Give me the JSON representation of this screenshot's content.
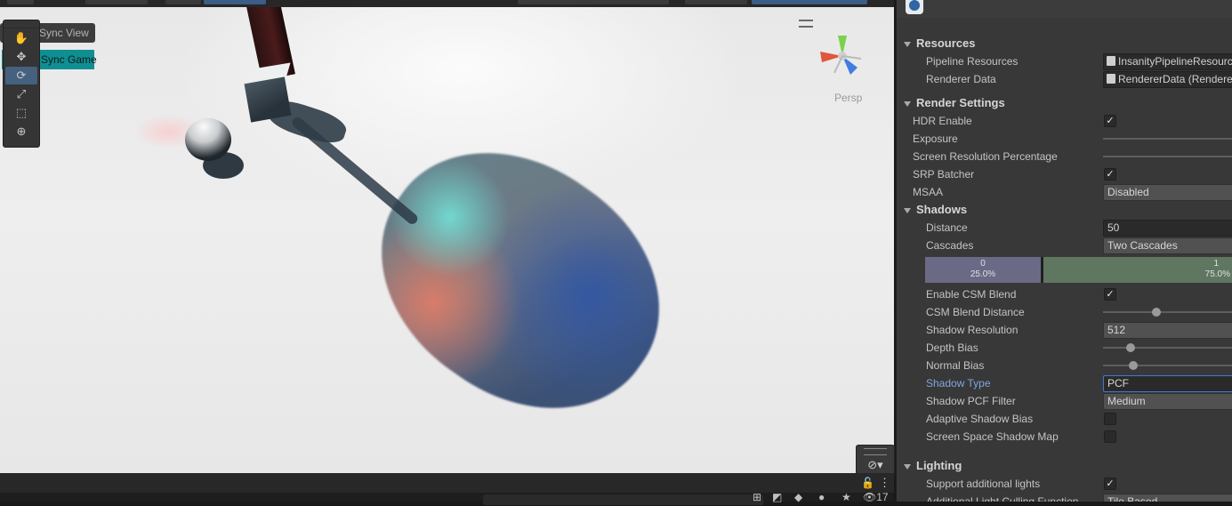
{
  "scene": {
    "sync_view_label": "Sync View",
    "sync_game_label": "Sync Game",
    "camera_mode": "Persp",
    "tools": [
      "hand-tool",
      "move-tool",
      "rotate-tool",
      "scale-tool",
      "rect-tool",
      "transform-tool"
    ],
    "active_tool": "rotate-tool",
    "visibility_count": "17"
  },
  "inspector": {
    "resources": {
      "title": "Resources",
      "pipeline_resources_label": "Pipeline Resources",
      "pipeline_resources_value": "InsanityPipelineResources",
      "renderer_data_label": "Renderer Data",
      "renderer_data_value": "RendererData (RendererData)"
    },
    "render_settings": {
      "title": "Render Settings",
      "hdr_label": "HDR Enable",
      "hdr_checked": true,
      "exposure_label": "Exposure",
      "screen_res_label": "Screen Resolution Percentage",
      "srp_batcher_label": "SRP Batcher",
      "srp_batcher_checked": true,
      "msaa_label": "MSAA",
      "msaa_value": "Disabled"
    },
    "shadows": {
      "title": "Shadows",
      "distance_label": "Distance",
      "distance_value": "50",
      "cascades_label": "Cascades",
      "cascades_value": "Two Cascades",
      "cascade_0_index": "0",
      "cascade_0_percent": "25.0%",
      "cascade_1_index": "1",
      "cascade_1_percent": "75.0%",
      "cascade_split": 0.25,
      "csm_blend_label": "Enable CSM Blend",
      "csm_blend_checked": true,
      "csm_blend_distance_label": "CSM Blend Distance",
      "csm_blend_distance_level": 0.4,
      "shadow_resolution_label": "Shadow Resolution",
      "shadow_resolution_value": "512",
      "depth_bias_label": "Depth Bias",
      "depth_bias_level": 0.2,
      "normal_bias_label": "Normal Bias",
      "normal_bias_level": 0.22,
      "shadow_type_label": "Shadow Type",
      "shadow_type_value": "PCF",
      "pcf_filter_label": "Shadow PCF Filter",
      "pcf_filter_value": "Medium",
      "adaptive_bias_label": "Adaptive Shadow Bias",
      "adaptive_bias_checked": false,
      "screen_space_label": "Screen Space Shadow Map",
      "screen_space_checked": false
    },
    "lighting": {
      "title": "Lighting",
      "additional_lights_label": "Support additional lights",
      "additional_lights_checked": true,
      "culling_label": "Additional Light Culling Function",
      "culling_value": "Tile Based"
    }
  },
  "colors": {
    "accent_blue": "#7ea6e0",
    "sync_game_bg": "#0f8f92",
    "cascade_0": "#6a6a86",
    "cascade_1": "#5f7760"
  }
}
